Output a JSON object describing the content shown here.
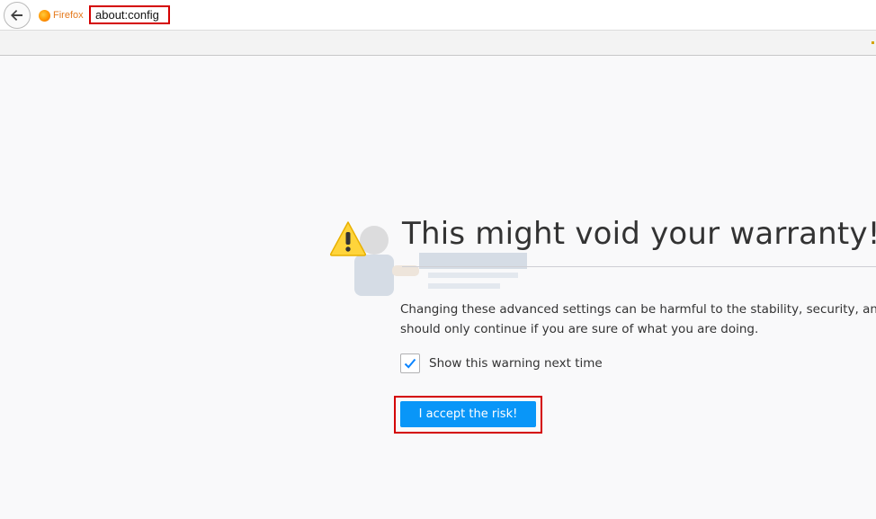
{
  "browser": {
    "identity_label": "Firefox",
    "url": "about:config"
  },
  "warning": {
    "title": "This might void your warranty!",
    "description": "Changing these advanced settings can be harmful to the stability, security, and p",
    "description_line2": "should only continue if you are sure of what you are doing.",
    "checkbox_label": "Show this warning next time",
    "checkbox_checked": true,
    "accept_label": "I accept the risk!"
  },
  "colors": {
    "accent": "#0996f8",
    "highlight": "#d40000",
    "warning": "#ffd43b"
  },
  "icons": [
    "back-arrow-icon",
    "firefox-icon",
    "warning-triangle-icon",
    "checkmark-icon"
  ]
}
